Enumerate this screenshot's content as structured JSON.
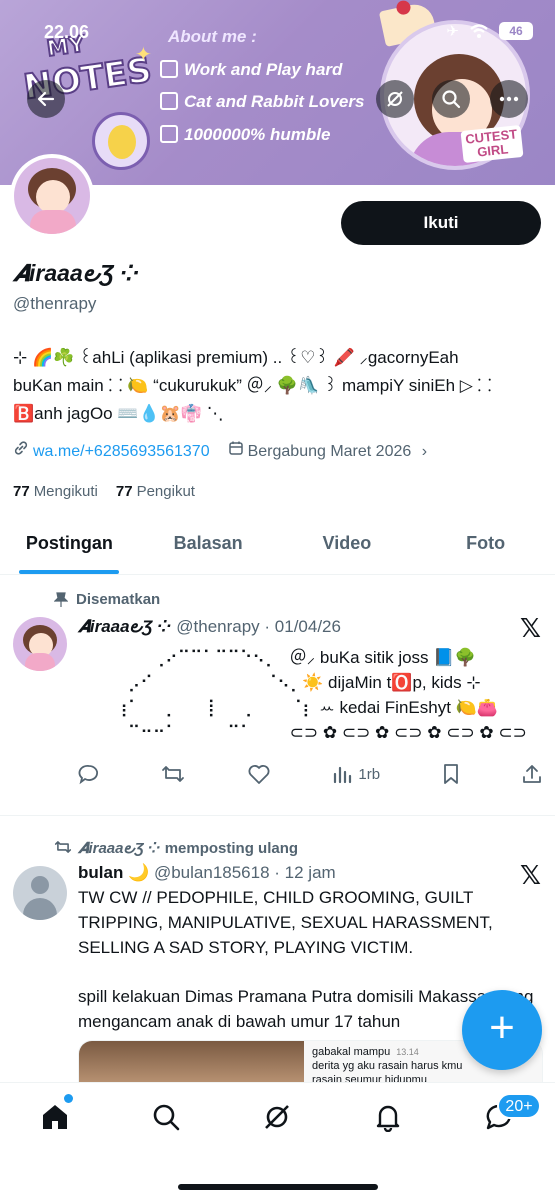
{
  "status_bar": {
    "time": "22.06",
    "battery": "46"
  },
  "banner": {
    "my": "MY",
    "notes": "NOTES",
    "about_title": "About me :",
    "about_items": [
      "Work and Play hard",
      "Cat and Rabbit Lovers",
      "1000000% humble"
    ],
    "cutest_line1": "CUTEST",
    "cutest_line2": "GIRL"
  },
  "profile": {
    "follow_label": "Ikuti",
    "display_name": "𝑨iraaa౿Ʒ ⁘",
    "handle": "@thenrapy",
    "bio_line1": "⊹ 🌈☘️ ꒰ahLi (aplikasi premium) .. ꒰♡꒱ 🖍️ ⸝gacornyEah",
    "bio_line2": "buKan main ⸬ 🍋 “cukurukuk” ＠⸝ 🌳🛝 ꒱ mampiY siniEh ▷ ⸬",
    "bio_line3": "🅱️anh jagOo ⌨️💧🐹👘 ⋱",
    "link": "wa.me/+6285693561370",
    "joined": "Bergabung Maret 2026",
    "following_count": "77",
    "following_label": "Mengikuti",
    "followers_count": "77",
    "followers_label": "Pengikut"
  },
  "tabs": [
    "Postingan",
    "Balasan",
    "Video",
    "Foto"
  ],
  "pinned": {
    "label": "Disematkan",
    "name": "𝑨iraaa౿Ʒ ⁘",
    "meta": "@thenrapy · 01/04/26",
    "lines": [
      "⠀⠀⠀⠀⠀⠀⢀⠔⠉⠉⠁⠉⠉⠑⠢⡀⠀＠⸝ buKa sitik joss 📘🌳",
      "⠀⠀⠀⠀⡠⠊⠀⠀⠀⠀⠀⠀⠀⠀⠀⠈⠢⡀☀️ dijaMin t🅾️p, kids ⊹",
      "⠀⠀⠀⢰⠁⠀⠀⡀⠀⠀⢸⠀⠀⢀⠀⠀⠀⠈⡆ ꕀ kedai FinEshyt 🍋👛",
      "⠀⠀⠀⠀⠉⠒⠒⠁⠀⠀⠀⠀⠉⠁⠀⠀⠀⊂⊃ ✿ ⊂⊃ ✿ ⊂⊃ ✿ ⊂⊃ ✿ ⊂⊃"
    ],
    "views": "1rb"
  },
  "repost": {
    "label": "memposting ulang",
    "reposter": "𝑨iraaa౿Ʒ ⁘",
    "name": "bulan 🌙",
    "meta": "@bulan185618 · 12 jam",
    "para1": "TW CW // PEDOPHILE, CHILD GROOMING, GUILT TRIPPING, MANIPULATIVE, SEXUAL HARASSMENT, SELLING A SAD STORY, PLAYING VICTIM.",
    "para2": "spill kelakuan Dimas Pramana Putra domisili Makassar yang mengancam anak di bawah umur 17 tahun",
    "media_line1": "gabakal mampu",
    "media_time": "13.14",
    "media_line2": "derita yg aku rasain harus kmu",
    "media_line3": "rasain seumur hidupmu"
  },
  "nav": {
    "badge": "20+"
  }
}
